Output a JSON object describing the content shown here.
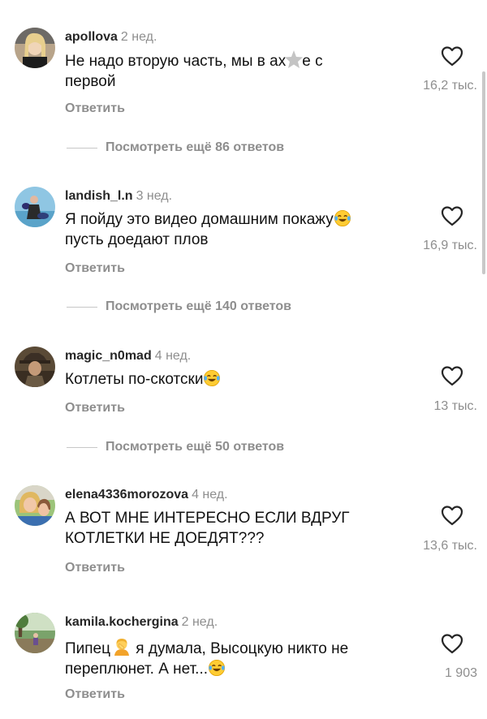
{
  "comments": [
    {
      "username": "apollova",
      "time": "2 нед.",
      "text_line1": "Не надо вторую часть, мы в ах",
      "text_line1_after": "е с",
      "text_line2": "первой",
      "reply_label": "Ответить",
      "likes": "16,2 тыс.",
      "view_more": "Посмотреть ещё 86 ответов"
    },
    {
      "username": "landish_l.n",
      "time": "3 нед.",
      "text_line1": "Я пойду это видео домашним покажу",
      "text_line2": "пусть доедают плов",
      "reply_label": "Ответить",
      "likes": "16,9 тыс.",
      "view_more": "Посмотреть ещё 140 ответов"
    },
    {
      "username": "magic_n0mad",
      "time": "4 нед.",
      "text_line1": "Котлеты по-скотски",
      "reply_label": "Ответить",
      "likes": "13 тыс.",
      "view_more": "Посмотреть ещё 50 ответов"
    },
    {
      "username": "elena4336morozova",
      "time": "4 нед.",
      "text_line1": "А ВОТ МНЕ ИНТЕРЕСНО ЕСЛИ ВДРУГ",
      "text_line2": "КОТЛЕТКИ НЕ ДОЕДЯТ???",
      "reply_label": "Ответить",
      "likes": "13,6 тыс."
    },
    {
      "username": "kamila.kochergina",
      "time": "2 нед.",
      "text_line1_before": "Пипец",
      "text_line1_after": " я думала, Высоцкую никто не",
      "text_line2": "переплюнет. А нет...",
      "reply_label": "Ответить",
      "likes": "1 903"
    }
  ],
  "icons": {
    "like": "heart-outline-icon",
    "laugh": "face-with-tears-of-joy-emoji",
    "facepalm": "facepalm-emoji",
    "censor": "star-sticker-icon"
  },
  "colors": {
    "text": "#111111",
    "secondary": "#8e8e8e",
    "divider": "#c7c7c7"
  }
}
